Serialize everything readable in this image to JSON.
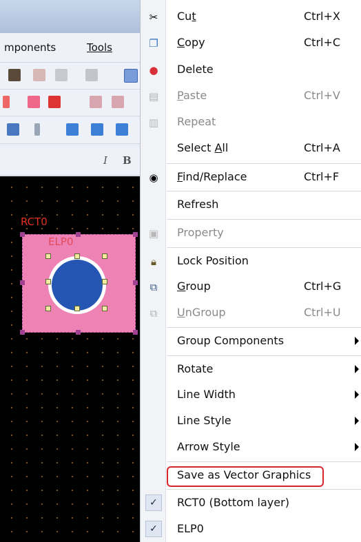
{
  "app": {
    "menubar": {
      "components": "mponents",
      "tools": "Tools"
    },
    "font_row": {
      "italic": "I",
      "bold": "B"
    },
    "canvas": {
      "rect_label": "RCT0",
      "ellipse_label": "ELP0"
    }
  },
  "context_menu": {
    "cut": {
      "label_pre": "Cu",
      "label_u": "t",
      "shortcut": "Ctrl+X"
    },
    "copy": {
      "label_u": "C",
      "label_post": "opy",
      "shortcut": "Ctrl+C"
    },
    "delete": {
      "label": "Delete"
    },
    "paste": {
      "label_u": "P",
      "label_post": "aste",
      "shortcut": "Ctrl+V"
    },
    "repeat": {
      "label": "Repeat"
    },
    "select_all": {
      "label_pre": "Select ",
      "label_u": "A",
      "label_post": "ll",
      "shortcut": "Ctrl+A"
    },
    "find_replace": {
      "label_u": "F",
      "label_post": "ind/Replace",
      "shortcut": "Ctrl+F"
    },
    "refresh": {
      "label": "Refresh"
    },
    "property": {
      "label": "Property"
    },
    "lock_position": {
      "label": "Lock Position"
    },
    "group": {
      "label_u": "G",
      "label_post": "roup",
      "shortcut": "Ctrl+G"
    },
    "ungroup": {
      "label_u": "U",
      "label_post": "nGroup",
      "shortcut": "Ctrl+U"
    },
    "group_components": {
      "label": "Group Components"
    },
    "rotate": {
      "label": "Rotate"
    },
    "line_width": {
      "label": "Line Width"
    },
    "line_style": {
      "label": "Line Style"
    },
    "arrow_style": {
      "label": "Arrow Style"
    },
    "save_vector": {
      "label": "Save as Vector Graphics"
    },
    "layer_rct0": {
      "label": "RCT0 (Bottom layer)",
      "check": "✓"
    },
    "layer_elp0": {
      "label": "ELP0",
      "check": "✓"
    }
  }
}
